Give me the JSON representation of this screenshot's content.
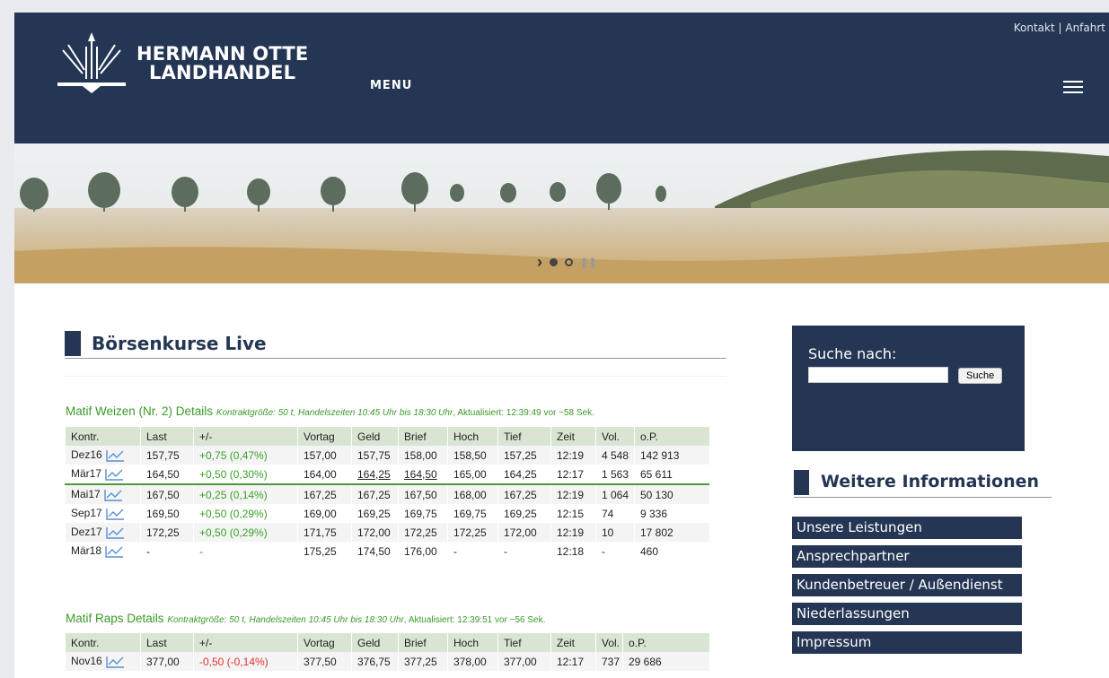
{
  "header": {
    "brand_line1": "HERMANN OTTE",
    "brand_line2": "LANDHANDEL",
    "menu_label": "MENU",
    "link_kontakt": "Kontakt",
    "link_separator": "|",
    "link_anfahrt": "Anfahrt"
  },
  "section_title": "Börsenkurse Live",
  "weizen": {
    "title": "Matif Weizen (Nr. 2) Details",
    "info": "Kontraktgröße: 50 t, Handelszeiten 10:45 Uhr bis 18:30 Uhr",
    "updated": "Aktualisiert: 12:39:49 vor ~58 Sek.",
    "columns": [
      "Kontr.",
      "Last",
      "+/-",
      "Vortag",
      "Geld",
      "Brief",
      "Hoch",
      "Tief",
      "Zeit",
      "Vol.",
      "o.P."
    ],
    "rows": [
      [
        "Dez16",
        "157,75",
        "+0,75 (0,47%)",
        "157,00",
        "157,75",
        "158,00",
        "158,50",
        "157,25",
        "12:19",
        "4 548",
        "142 913"
      ],
      [
        "Mär17",
        "164,50",
        "+0,50 (0,30%)",
        "164,00",
        "164,25",
        "164,50",
        "165,00",
        "164,25",
        "12:17",
        "1 563",
        "65 611"
      ],
      [
        "Mai17",
        "167,50",
        "+0,25 (0,14%)",
        "167,25",
        "167,25",
        "167,50",
        "168,00",
        "167,25",
        "12:19",
        "1 064",
        "50 130"
      ],
      [
        "Sep17",
        "169,50",
        "+0,50 (0,29%)",
        "169,00",
        "169,25",
        "169,75",
        "169,75",
        "169,25",
        "12:15",
        "74",
        "9 336"
      ],
      [
        "Dez17",
        "172,25",
        "+0,50 (0,29%)",
        "171,75",
        "172,00",
        "172,25",
        "172,25",
        "172,00",
        "12:19",
        "10",
        "17 802"
      ],
      [
        "Mär18",
        "-",
        "-",
        "175,25",
        "174,50",
        "176,00",
        "-",
        "-",
        "12:18",
        "-",
        "460"
      ]
    ]
  },
  "raps": {
    "title": "Matif Raps Details",
    "info": "Kontraktgröße: 50 t, Handelszeiten 10:45 Uhr bis 18:30 Uhr",
    "updated": "Aktualisiert: 12:39:51 vor ~56 Sek.",
    "columns": [
      "Kontr.",
      "Last",
      "+/-",
      "Vortag",
      "Geld",
      "Brief",
      "Hoch",
      "Tief",
      "Zeit",
      "Vol.",
      "o.P."
    ],
    "rows": [
      [
        "Nov16",
        "377,00",
        "-0,50 (-0,14%)",
        "377,50",
        "376,75",
        "377,25",
        "378,00",
        "377,00",
        "12:17",
        "737",
        "29 686"
      ]
    ]
  },
  "sidebar": {
    "search_label": "Suche nach:",
    "search_value": "",
    "search_button": "Suche",
    "info_title": "Weitere Informationen",
    "links": [
      "Unsere Leistungen",
      "Ansprechpartner",
      "Kundenbetreuer / Außendienst",
      "Niederlassungen",
      "Impressum"
    ]
  },
  "colors": {
    "navy": "#243654",
    "green_text": "#3a9a2a",
    "negative": "#e03030"
  }
}
